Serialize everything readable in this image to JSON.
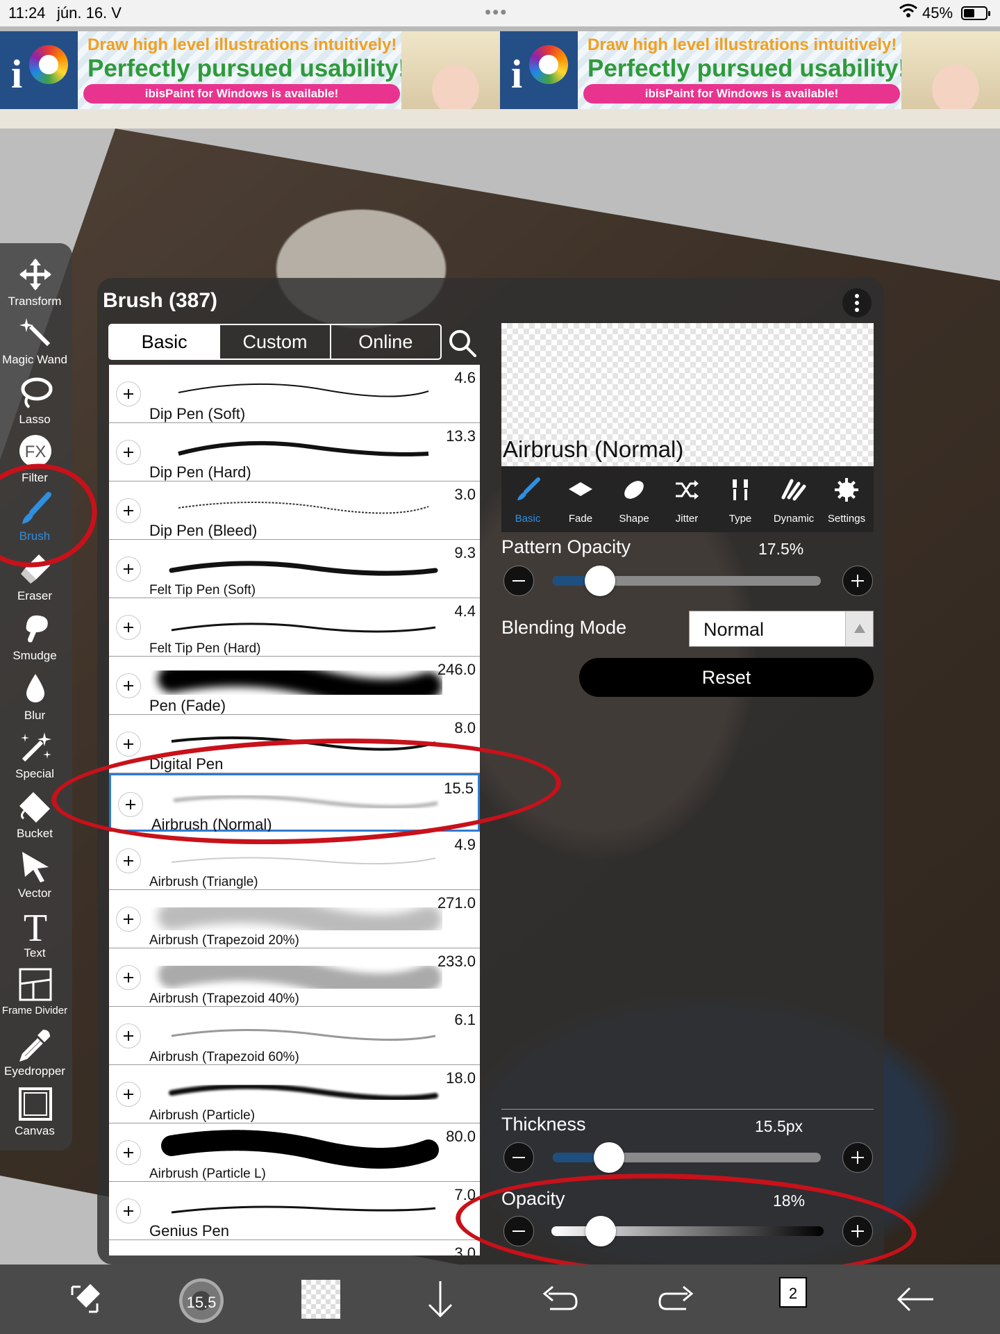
{
  "status": {
    "time": "11:24",
    "date": "jún. 16. V",
    "battery": "45%"
  },
  "ad": {
    "line1": "Draw high level illustrations intuitively!",
    "line2": "Perfectly pursued usability!",
    "pill": "ibisPaint for Windows is available!"
  },
  "toolbar": {
    "tools": [
      {
        "label": "Transform",
        "icon": "transform-icon"
      },
      {
        "label": "Magic Wand",
        "icon": "magic-wand-icon"
      },
      {
        "label": "Lasso",
        "icon": "lasso-icon"
      },
      {
        "label": "Filter",
        "icon": "fx-icon"
      },
      {
        "label": "Brush",
        "icon": "brush-icon",
        "active": true
      },
      {
        "label": "Eraser",
        "icon": "eraser-icon"
      },
      {
        "label": "Smudge",
        "icon": "smudge-icon"
      },
      {
        "label": "Blur",
        "icon": "blur-icon"
      },
      {
        "label": "Special",
        "icon": "special-icon"
      },
      {
        "label": "Bucket",
        "icon": "bucket-icon"
      },
      {
        "label": "Vector",
        "icon": "vector-icon"
      },
      {
        "label": "Text",
        "icon": "text-icon"
      },
      {
        "label": "Frame Divider",
        "icon": "frame-divider-icon"
      },
      {
        "label": "Eyedropper",
        "icon": "eyedropper-icon"
      },
      {
        "label": "Canvas",
        "icon": "canvas-icon"
      }
    ]
  },
  "panel": {
    "title": "Brush (387)",
    "tabs": [
      "Basic",
      "Custom",
      "Online"
    ],
    "selected_tab": "Basic",
    "brushes": [
      {
        "name": "Dip Pen (Soft)",
        "size": "4.6"
      },
      {
        "name": "Dip Pen (Hard)",
        "size": "13.3"
      },
      {
        "name": "Dip Pen (Bleed)",
        "size": "3.0"
      },
      {
        "name": "Felt Tip Pen (Soft)",
        "size": "9.3"
      },
      {
        "name": "Felt Tip Pen (Hard)",
        "size": "4.4"
      },
      {
        "name": "Pen (Fade)",
        "size": "246.0"
      },
      {
        "name": "Digital Pen",
        "size": "8.0"
      },
      {
        "name": "Airbrush (Normal)",
        "size": "15.5",
        "selected": true
      },
      {
        "name": "Airbrush (Triangle)",
        "size": "4.9"
      },
      {
        "name": "Airbrush (Trapezoid 20%)",
        "size": "271.0"
      },
      {
        "name": "Airbrush (Trapezoid 40%)",
        "size": "233.0"
      },
      {
        "name": "Airbrush (Trapezoid 60%)",
        "size": "6.1"
      },
      {
        "name": "Airbrush (Particle)",
        "size": "18.0"
      },
      {
        "name": "Airbrush (Particle L)",
        "size": "80.0"
      },
      {
        "name": "Genius Pen",
        "size": "7.0"
      },
      {
        "name": "",
        "size": "3.0"
      }
    ],
    "preview_name": "Airbrush (Normal)",
    "param_tabs": [
      "Basic",
      "Fade",
      "Shape",
      "Jitter",
      "Type",
      "Dynamic",
      "Settings"
    ],
    "pattern_opacity": {
      "label": "Pattern Opacity",
      "value": "17.5%",
      "level": 0.175
    },
    "blending_mode": {
      "label": "Blending Mode",
      "value": "Normal"
    },
    "reset_label": "Reset",
    "thickness": {
      "label": "Thickness",
      "value": "15.5px",
      "level": 0.21
    },
    "opacity": {
      "label": "Opacity",
      "value": "18%",
      "level": 0.18
    }
  },
  "bottombar": {
    "brush_size": "15.5",
    "layer_count": "2"
  }
}
